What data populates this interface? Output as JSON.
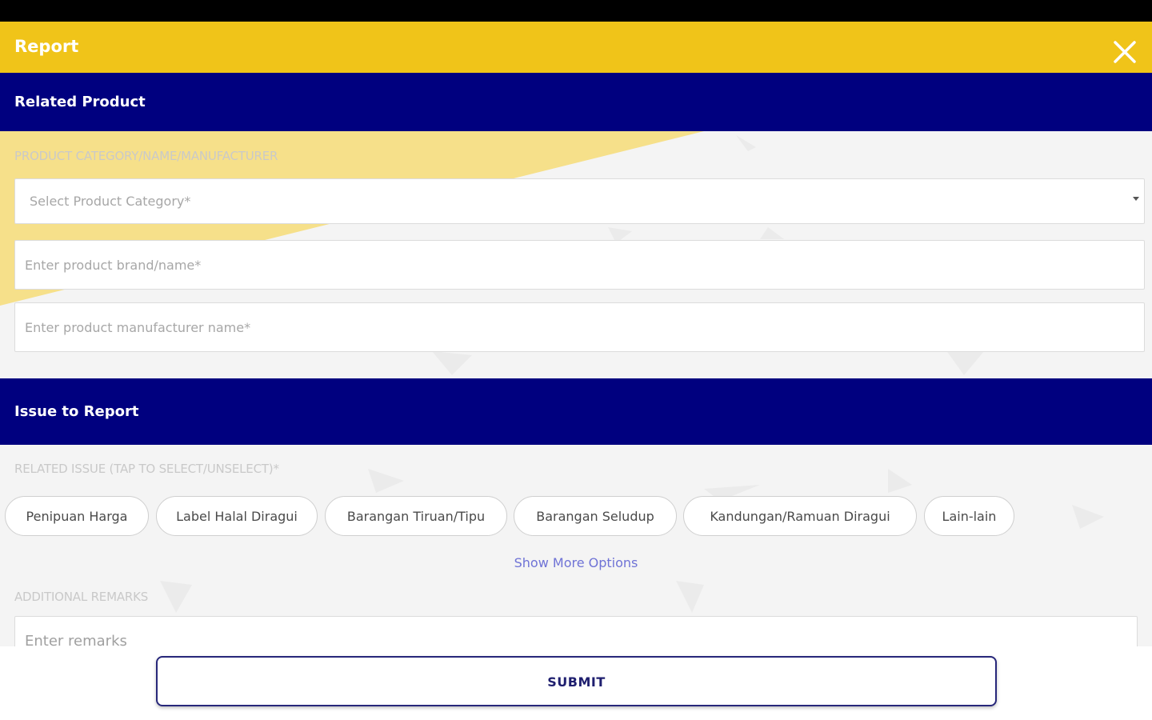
{
  "header": {
    "title": "Report",
    "close_icon": "close-icon"
  },
  "colors": {
    "header_bg": "#f0c419",
    "section_bg": "#00007f",
    "link": "#6f73d6",
    "submit_border": "#27277a"
  },
  "sections": {
    "related_product": {
      "title": "Related Product",
      "label": "PRODUCT CATEGORY/NAME/MANUFACTURER",
      "category_select": {
        "placeholder": "Select Product Category*"
      },
      "brand_input": {
        "placeholder": "Enter product brand/name*"
      },
      "manufacturer_input": {
        "placeholder": "Enter product manufacturer name*"
      }
    },
    "issue": {
      "title": "Issue to Report",
      "label": "RELATED ISSUE (TAP TO SELECT/UNSELECT)*",
      "chips": [
        "Penipuan Harga",
        "Label Halal Diragui",
        "Barangan Tiruan/Tipu",
        "Barangan Seludup",
        "Kandungan/Ramuan Diragui",
        "Lain-lain"
      ],
      "show_more": "Show More Options",
      "remarks_label": "ADDITIONAL REMARKS",
      "remarks_placeholder": "Enter remarks"
    }
  },
  "submit": {
    "label": "SUBMIT"
  }
}
